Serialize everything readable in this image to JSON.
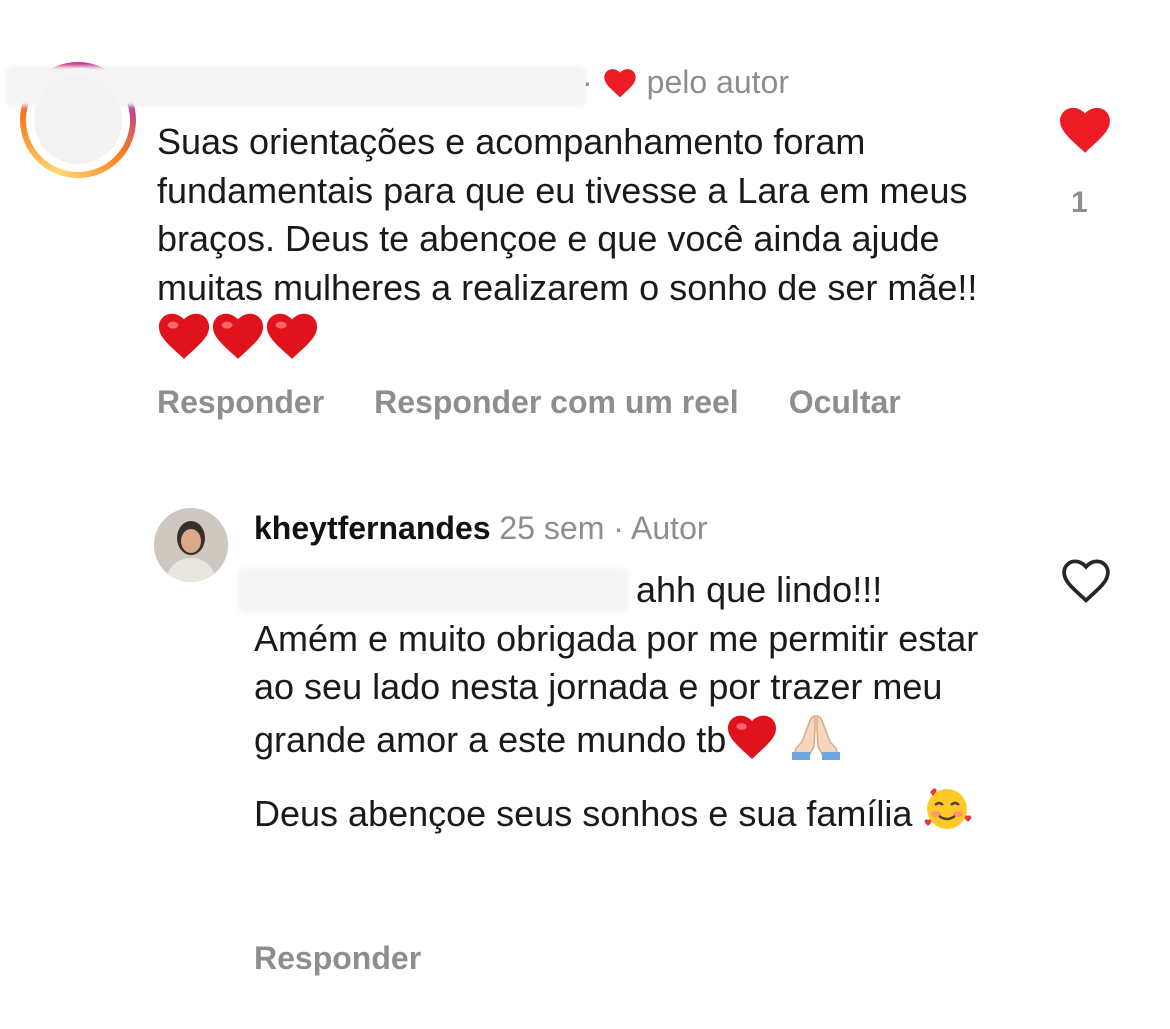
{
  "comment": {
    "author_badge": "pelo autor",
    "meta_separator": "·",
    "text": "Suas orientações e acompanhamento foram fundamentais para que eu tivesse a Lara em meus braços. Deus te abençoe e que você ainda ajude muitas mulheres a realizarem o sonho de ser mãe!!",
    "like_count": "1",
    "actions": [
      "Responder",
      "Responder com um reel",
      "Ocultar"
    ],
    "trailing_emojis": [
      "red-heart",
      "red-heart",
      "red-heart"
    ]
  },
  "reply": {
    "username": "kheytfernandes",
    "time": "25 sem",
    "separator": "·",
    "role": "Autor",
    "line1": "ahh que lindo!!!",
    "line2": "Amém e muito obrigada por me permitir estar ao seu lado nesta jornada e por trazer meu grande amor a este mundo tb",
    "line3": "Deus abençoe seus sonhos e sua família",
    "action": "Responder"
  },
  "colors": {
    "heart_red": "#ED1C24",
    "muted_gray": "#8E8E8E",
    "text": "#1A1A1A"
  },
  "icons": [
    "heart-filled-icon",
    "heart-outline-icon",
    "heart-small-icon"
  ]
}
